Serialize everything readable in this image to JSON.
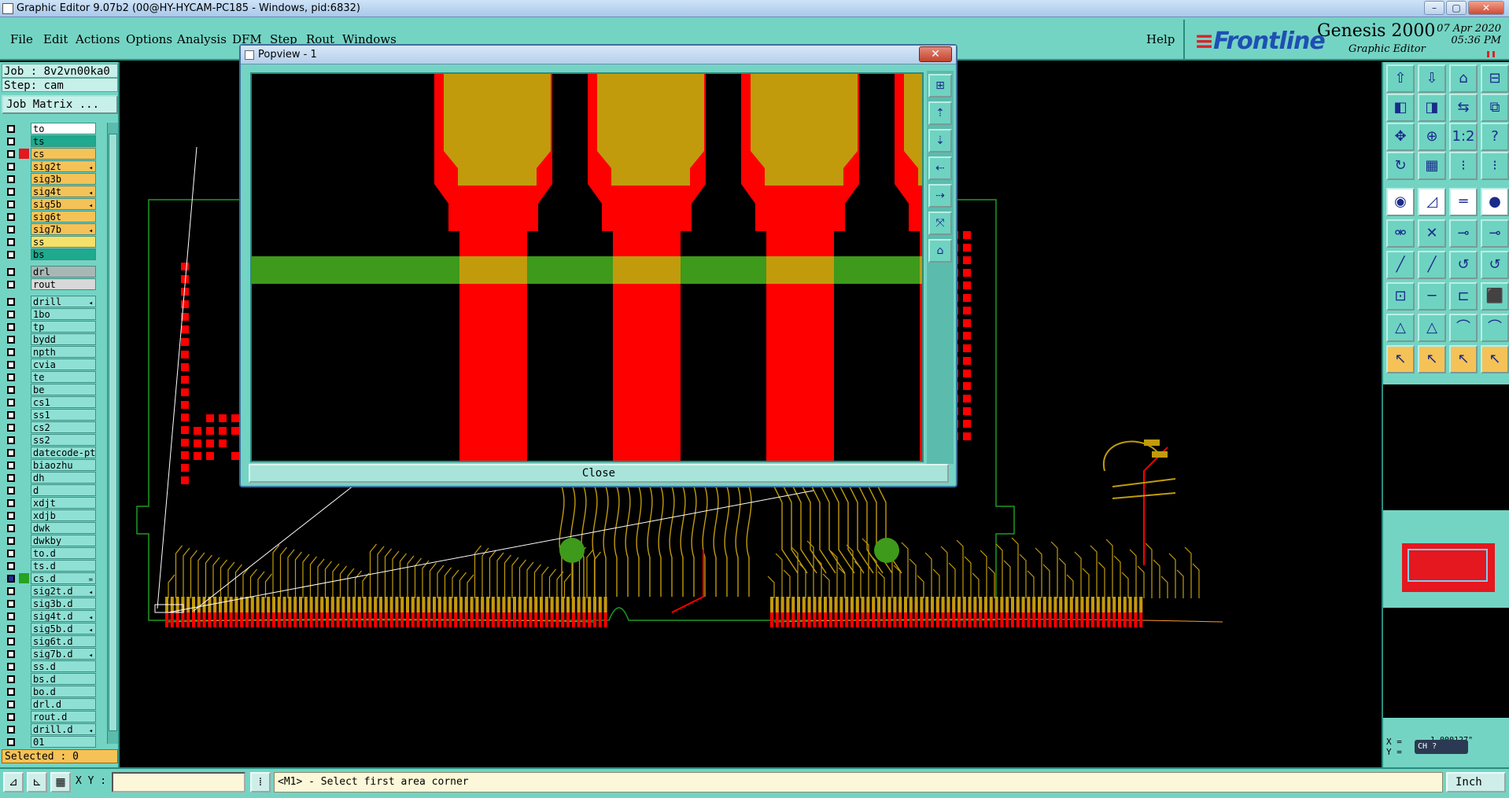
{
  "window": {
    "title": "Graphic Editor 9.07b2 (00@HY-HYCAM-PC185 - Windows, pid:6832)",
    "controls": [
      "–",
      "▢",
      "✕"
    ]
  },
  "menu": {
    "items": [
      "File",
      "Edit",
      "Actions",
      "Options",
      "Analysis",
      "DFM",
      "Step",
      "Rout",
      "Windows"
    ],
    "help": "Help"
  },
  "brand": {
    "logo": "Frontline",
    "product": "Genesis 2000",
    "subtitle": "Graphic Editor",
    "date": "07 Apr 2020",
    "time": "05:36 PM"
  },
  "left_panel": {
    "job": "Job : 8v2vn00ka0",
    "step": "Step: cam",
    "job_matrix": "Job Matrix ...",
    "selected": "Selected : 0",
    "layers": [
      {
        "name": "to",
        "bg": "#ffffff",
        "mark": ""
      },
      {
        "name": "ts",
        "bg": "#1fa98e",
        "mark": ""
      },
      {
        "name": "cs",
        "bg": "#f5c257",
        "mark": "#e5171f"
      },
      {
        "name": "sig2t",
        "bg": "#f5c257",
        "mark": "",
        "flag": "◂"
      },
      {
        "name": "sig3b",
        "bg": "#f5c257",
        "mark": ""
      },
      {
        "name": "sig4t",
        "bg": "#f5c257",
        "mark": "",
        "flag": "◂"
      },
      {
        "name": "sig5b",
        "bg": "#f5c257",
        "mark": "",
        "flag": "◂"
      },
      {
        "name": "sig6t",
        "bg": "#f5c257",
        "mark": ""
      },
      {
        "name": "sig7b",
        "bg": "#f5c257",
        "mark": "",
        "flag": "◂"
      },
      {
        "name": "ss",
        "bg": "#f5e06a",
        "mark": ""
      },
      {
        "name": "bs",
        "bg": "#1fa98e",
        "mark": ""
      },
      {
        "name": "drl",
        "bg": "#a9b7b4",
        "mark": ""
      },
      {
        "name": "rout",
        "bg": "#d8d8d8",
        "mark": ""
      },
      {
        "name": "drill",
        "bg": "#8fe0d4",
        "mark": "",
        "flag": "◂"
      },
      {
        "name": "1bo",
        "bg": "#8fe0d4",
        "mark": ""
      },
      {
        "name": "tp",
        "bg": "#8fe0d4",
        "mark": ""
      },
      {
        "name": "bydd",
        "bg": "#8fe0d4",
        "mark": ""
      },
      {
        "name": "npth",
        "bg": "#8fe0d4",
        "mark": ""
      },
      {
        "name": "cvia",
        "bg": "#8fe0d4",
        "mark": ""
      },
      {
        "name": "te",
        "bg": "#8fe0d4",
        "mark": ""
      },
      {
        "name": "be",
        "bg": "#8fe0d4",
        "mark": ""
      },
      {
        "name": "cs1",
        "bg": "#8fe0d4",
        "mark": ""
      },
      {
        "name": "ss1",
        "bg": "#8fe0d4",
        "mark": ""
      },
      {
        "name": "cs2",
        "bg": "#8fe0d4",
        "mark": ""
      },
      {
        "name": "ss2",
        "bg": "#8fe0d4",
        "mark": ""
      },
      {
        "name": "datecode-pte",
        "bg": "#8fe0d4",
        "mark": ""
      },
      {
        "name": "biaozhu",
        "bg": "#8fe0d4",
        "mark": ""
      },
      {
        "name": "dh",
        "bg": "#8fe0d4",
        "mark": ""
      },
      {
        "name": "d",
        "bg": "#8fe0d4",
        "mark": ""
      },
      {
        "name": "xdjt",
        "bg": "#8fe0d4",
        "mark": ""
      },
      {
        "name": "xdjb",
        "bg": "#8fe0d4",
        "mark": ""
      },
      {
        "name": "dwk",
        "bg": "#8fe0d4",
        "mark": ""
      },
      {
        "name": "dwkby",
        "bg": "#8fe0d4",
        "mark": ""
      },
      {
        "name": "to.d",
        "bg": "#8fe0d4",
        "mark": ""
      },
      {
        "name": "ts.d",
        "bg": "#8fe0d4",
        "mark": ""
      },
      {
        "name": "cs.d",
        "bg": "#8fe0d4",
        "mark": "#27a322",
        "flag": "=",
        "active": true
      },
      {
        "name": "sig2t.d",
        "bg": "#8fe0d4",
        "mark": "",
        "flag": "◂"
      },
      {
        "name": "sig3b.d",
        "bg": "#8fe0d4",
        "mark": ""
      },
      {
        "name": "sig4t.d",
        "bg": "#8fe0d4",
        "mark": "",
        "flag": "◂"
      },
      {
        "name": "sig5b.d",
        "bg": "#8fe0d4",
        "mark": "",
        "flag": "◂"
      },
      {
        "name": "sig6t.d",
        "bg": "#8fe0d4",
        "mark": ""
      },
      {
        "name": "sig7b.d",
        "bg": "#8fe0d4",
        "mark": "",
        "flag": "◂"
      },
      {
        "name": "ss.d",
        "bg": "#8fe0d4",
        "mark": ""
      },
      {
        "name": "bs.d",
        "bg": "#8fe0d4",
        "mark": ""
      },
      {
        "name": "bo.d",
        "bg": "#8fe0d4",
        "mark": ""
      },
      {
        "name": "drl.d",
        "bg": "#8fe0d4",
        "mark": ""
      },
      {
        "name": "rout.d",
        "bg": "#8fe0d4",
        "mark": ""
      },
      {
        "name": "drill.d",
        "bg": "#8fe0d4",
        "mark": "",
        "flag": "◂"
      },
      {
        "name": "01",
        "bg": "#8fe0d4",
        "mark": ""
      }
    ]
  },
  "popview": {
    "title": "Popview - 1",
    "close_label": "Close"
  },
  "right_panel": {
    "x_label": "X =",
    "y_label": "Y =",
    "x_value": "1.000127\"",
    "ime": "CH"
  },
  "statusbar": {
    "xy_label": "X Y :",
    "xy_value": "",
    "prompt": "<M1> - Select first area corner",
    "unit": "Inch"
  },
  "colors": {
    "panel": "#74d4c4",
    "copper_red": "#fe0000",
    "copper_gold": "#c19b0c",
    "trace_green": "#3e9a1a",
    "selected_yellow": "#f5c257"
  }
}
